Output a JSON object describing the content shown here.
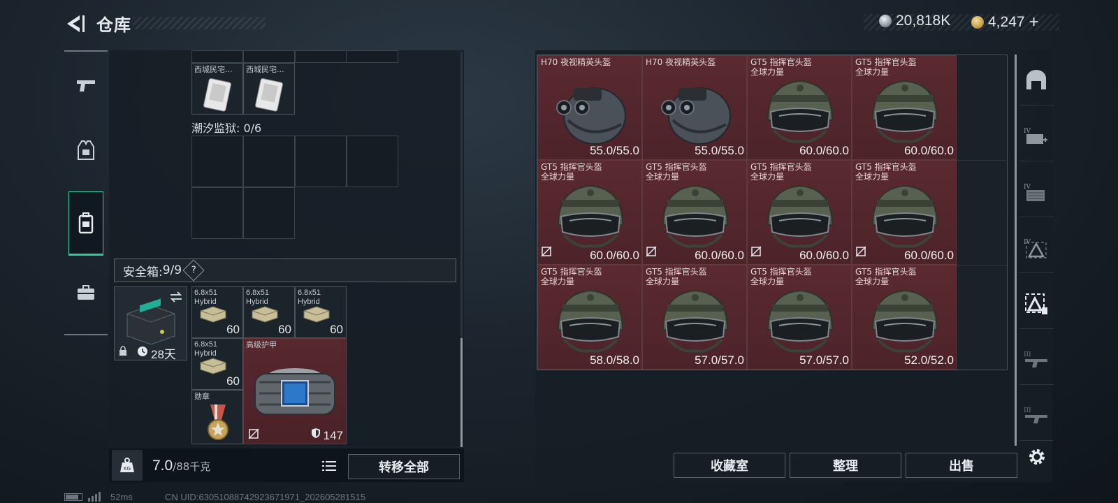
{
  "header": {
    "title": "仓库",
    "currencies": [
      {
        "icon": "silver-coin-icon",
        "value": "20,818K",
        "color": "#b8c2c9"
      },
      {
        "icon": "gold-coin-icon",
        "value": "4,247",
        "add": "+",
        "color": "#c9a24a"
      }
    ]
  },
  "left_nav": [
    {
      "icon": "pistol-icon"
    },
    {
      "icon": "armor-vest-icon"
    },
    {
      "icon": "backpack-icon",
      "active": true
    },
    {
      "icon": "briefcase-icon"
    }
  ],
  "top_items": [
    {
      "label": "西城民宅...",
      "icon": "keycard-icon"
    },
    {
      "label": "西城民宅...",
      "icon": "keycard-icon"
    }
  ],
  "prison": {
    "label": "潮汐监狱: 0/6"
  },
  "safe_box": {
    "label": "安全箱: ",
    "count": "9/9",
    "help": "?",
    "timer": "28天"
  },
  "safe_items": [
    {
      "label": "6.8x51\nHybrid",
      "qty": "60"
    },
    {
      "label": "6.8x51\nHybrid",
      "qty": "60"
    },
    {
      "label": "6.8x51\nHybrid",
      "qty": "60"
    },
    {
      "label": "6.8x51\nHybrid",
      "qty": "60"
    }
  ],
  "medal": {
    "label": "勋章"
  },
  "armor": {
    "label": "高级护甲",
    "durability": "147"
  },
  "weight": {
    "current": "7.0",
    "max": "/88千克"
  },
  "buttons": {
    "transfer_all": "转移全部",
    "collection": "收藏室",
    "sort": "整理",
    "sell": "出售"
  },
  "helmets": [
    {
      "name": "H70 夜视精英头盔",
      "durability": "55.0/55.0",
      "type": "nv",
      "locked": false
    },
    {
      "name": "H70 夜视精英头盔",
      "durability": "55.0/55.0",
      "type": "nv",
      "locked": false
    },
    {
      "name": "GT5 指挥官头盔\n全球力量",
      "durability": "60.0/60.0",
      "type": "gt5",
      "locked": false
    },
    {
      "name": "GT5 指挥官头盔\n全球力量",
      "durability": "60.0/60.0",
      "type": "gt5",
      "locked": false
    },
    {
      "name": "GT5 指挥官头盔\n全球力量",
      "durability": "60.0/60.0",
      "type": "gt5",
      "locked": true
    },
    {
      "name": "GT5 指挥官头盔\n全球力量",
      "durability": "60.0/60.0",
      "type": "gt5",
      "locked": true
    },
    {
      "name": "GT5 指挥官头盔\n全球力量",
      "durability": "60.0/60.0",
      "type": "gt5",
      "locked": true
    },
    {
      "name": "GT5 指挥官头盔\n全球力量",
      "durability": "60.0/60.0",
      "type": "gt5",
      "locked": true
    },
    {
      "name": "GT5 指挥官头盔\n全球力量",
      "durability": "58.0/58.0",
      "type": "gt5",
      "locked": false
    },
    {
      "name": "GT5 指挥官头盔\n全球力量",
      "durability": "57.0/57.0",
      "type": "gt5",
      "locked": false
    },
    {
      "name": "GT5 指挥官头盔\n全球力量",
      "durability": "57.0/57.0",
      "type": "gt5",
      "locked": false
    },
    {
      "name": "GT5 指挥官头盔\n全球力量",
      "durability": "52.0/52.0",
      "type": "gt5",
      "locked": false
    }
  ],
  "right_nav": [
    {
      "icon": "safehouse-icon"
    },
    {
      "icon": "medkit-tier4-icon",
      "tier": "IV"
    },
    {
      "icon": "container-tier4-icon",
      "tier": "IV"
    },
    {
      "icon": "armor-tier4-icon",
      "tier": "IV"
    },
    {
      "icon": "helmet-filter-icon",
      "active": true
    },
    {
      "icon": "rifle-tier3-icon",
      "tier": "III"
    },
    {
      "icon": "rifle-tier3b-icon",
      "tier": "III"
    }
  ],
  "status": {
    "ping": "52ms",
    "uid": "CN UID:630510887429236719​71_202605281515"
  }
}
